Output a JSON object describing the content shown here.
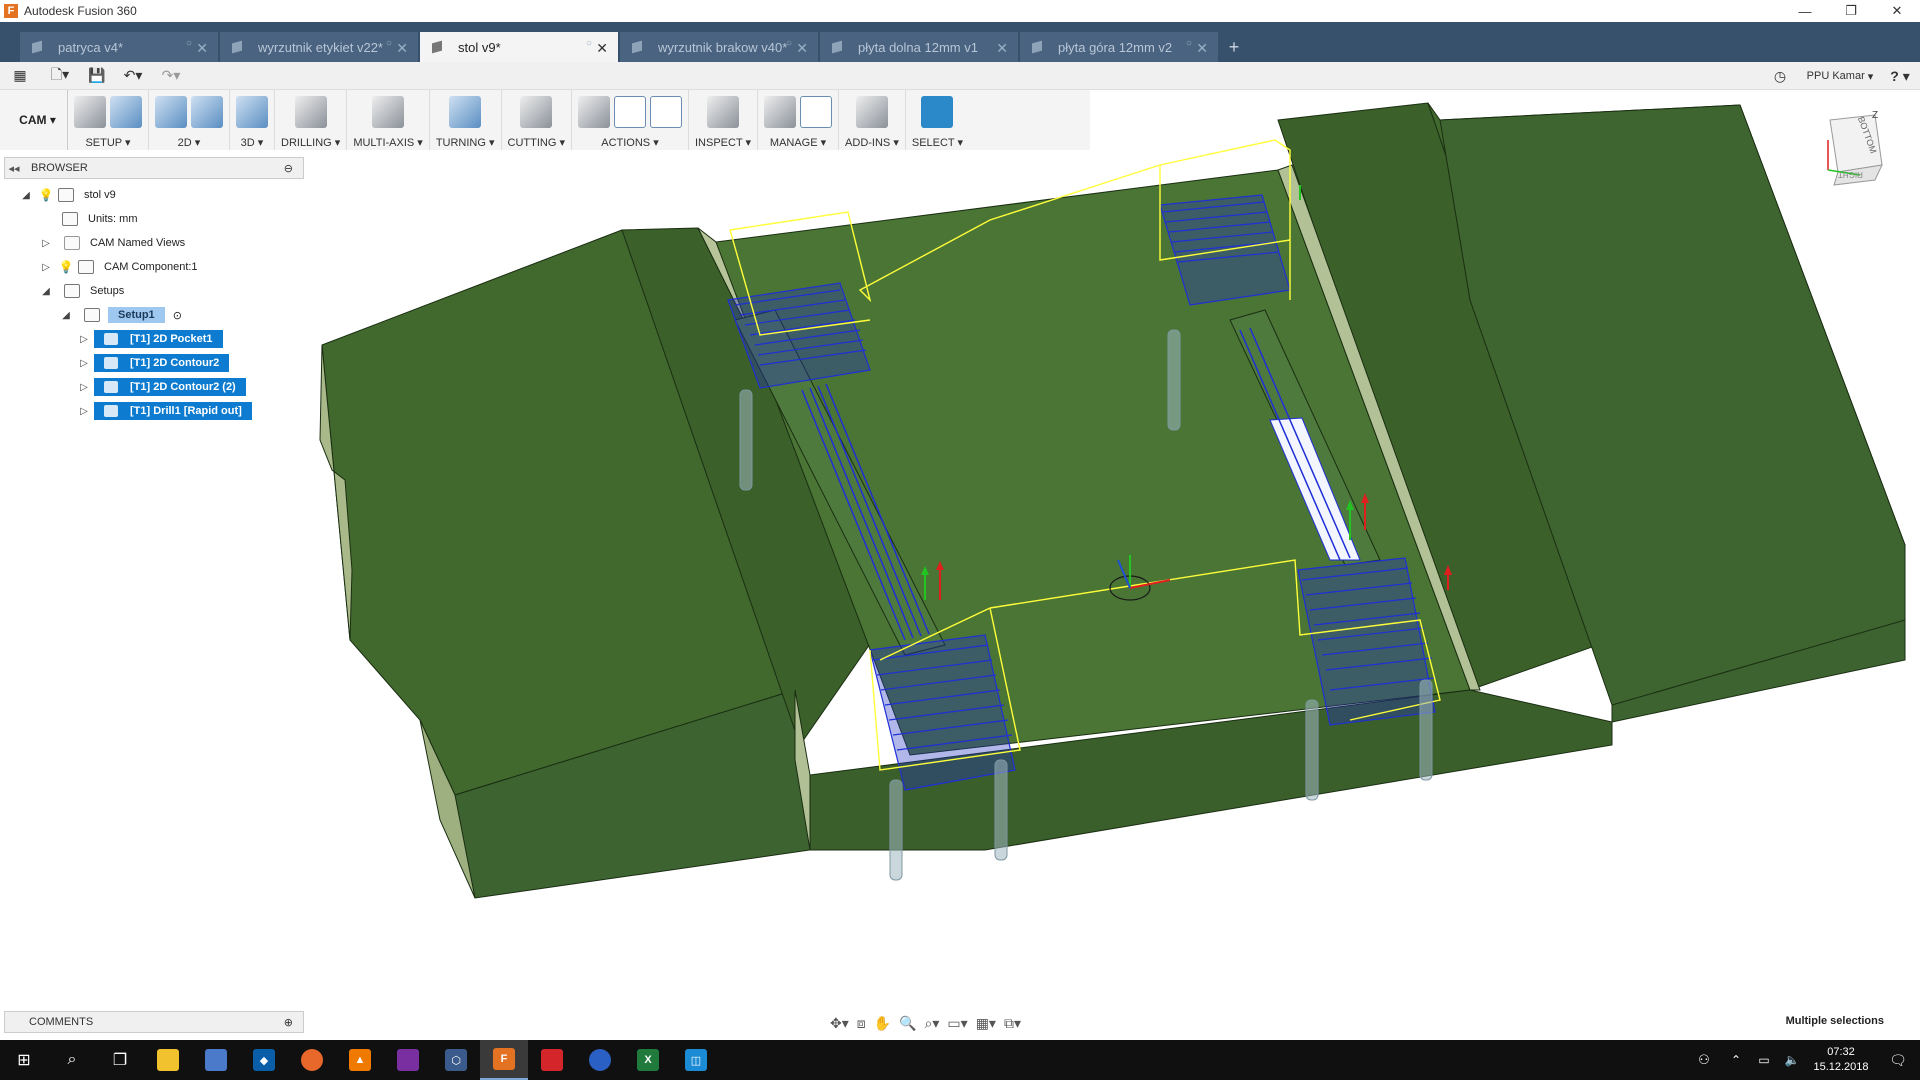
{
  "window": {
    "title": "Autodesk Fusion 360",
    "controls": [
      "—",
      "❐",
      "✕"
    ]
  },
  "tabs": [
    {
      "label": "patryca v4*",
      "active": false
    },
    {
      "label": "wyrzutnik etykiet v22*",
      "active": false
    },
    {
      "label": "stol v9*",
      "active": true
    },
    {
      "label": "wyrzutnik brakow v40*",
      "active": false
    },
    {
      "label": "płyta dolna 12mm v1",
      "active": false
    },
    {
      "label": "płyta góra 12mm v2",
      "active": false
    }
  ],
  "quickbar": {
    "user": "PPU Kamar",
    "help": "?"
  },
  "ribbon": {
    "workspace": "CAM",
    "groups": [
      {
        "label": "SETUP",
        "icons": 2
      },
      {
        "label": "2D",
        "icons": 2
      },
      {
        "label": "3D",
        "icons": 1
      },
      {
        "label": "DRILLING",
        "icons": 1
      },
      {
        "label": "MULTI-AXIS",
        "icons": 1
      },
      {
        "label": "TURNING",
        "icons": 1
      },
      {
        "label": "CUTTING",
        "icons": 1
      },
      {
        "label": "ACTIONS",
        "icons": 3
      },
      {
        "label": "INSPECT",
        "icons": 1
      },
      {
        "label": "MANAGE",
        "icons": 2
      },
      {
        "label": "ADD-INS",
        "icons": 1
      },
      {
        "label": "SELECT",
        "icons": 1
      }
    ]
  },
  "browser": {
    "title": "BROWSER",
    "root": "stol v9",
    "units": "Units: mm",
    "named_views": "CAM Named Views",
    "component": "CAM Component:1",
    "setups": "Setups",
    "setup1": "Setup1",
    "operations": [
      "[T1] 2D Pocket1",
      "[T1] 2D Contour2",
      "[T1] 2D Contour2 (2)",
      "[T1] Drill1 [Rapid out]"
    ]
  },
  "comments": {
    "title": "COMMENTS"
  },
  "status": {
    "selection": "Multiple selections"
  },
  "viewcube": {
    "faces": [
      "BOTTOM",
      "RIGHT"
    ],
    "axis": "Z"
  },
  "taskbar": {
    "time": "07:32",
    "date": "15.12.2018"
  },
  "colors": {
    "model_top": "#41692e",
    "model_side": "#2f5322",
    "model_light": "#a9b98a",
    "toolpath": "#1f2fd6",
    "rapid": "#ffff3a",
    "tab_bar": "#37516c",
    "selection": "#0d7bcf"
  }
}
